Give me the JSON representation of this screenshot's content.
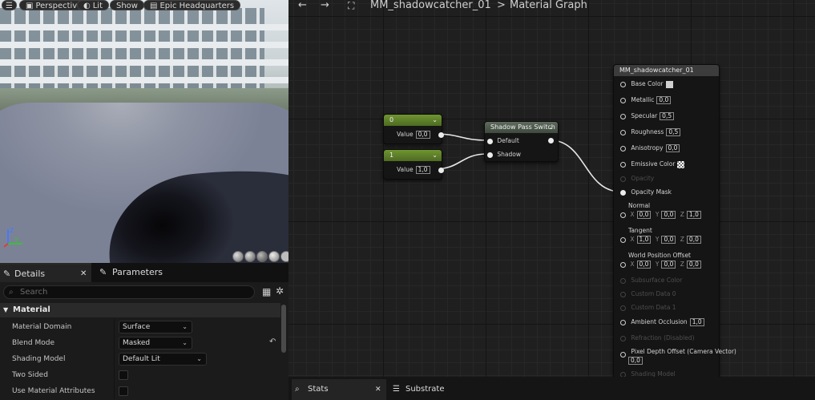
{
  "viewport": {
    "toolbar": {
      "perspective": "Perspective",
      "lit": "Lit",
      "show": "Show",
      "hdri": "Epic Headquarters"
    }
  },
  "details": {
    "tab_details": "Details",
    "tab_parameters": "Parameters",
    "search_placeholder": "Search",
    "category": "Material",
    "props": [
      {
        "name": "Material Domain",
        "value": "Surface"
      },
      {
        "name": "Blend Mode",
        "value": "Masked"
      },
      {
        "name": "Shading Model",
        "value": "Default Lit"
      },
      {
        "name": "Two Sided",
        "checked": false
      },
      {
        "name": "Use Material Attributes",
        "checked": false
      }
    ]
  },
  "graph": {
    "breadcrumb_asset": "MM_shadowcatcher_01",
    "breadcrumb_sep": ">",
    "breadcrumb_view": "Material Graph",
    "const0": {
      "title": "0",
      "label": "Value",
      "value": "0,0"
    },
    "const1": {
      "title": "1",
      "label": "Value",
      "value": "1,0"
    },
    "switch": {
      "title": "Shadow Pass Switch",
      "in_default": "Default",
      "in_shadow": "Shadow"
    },
    "result": {
      "title": "MM_shadowcatcher_01",
      "base_color": "Base Color",
      "metallic": "Metallic",
      "metallic_val": "0,0",
      "specular": "Specular",
      "specular_val": "0,5",
      "roughness": "Roughness",
      "roughness_val": "0,5",
      "anisotropy": "Anisotropy",
      "anisotropy_val": "0,0",
      "emissive": "Emissive Color",
      "opacity": "Opacity",
      "opacity_mask": "Opacity Mask",
      "normal": "Normal",
      "normal_x": "0,0",
      "normal_y": "0,0",
      "normal_z": "1,0",
      "tangent": "Tangent",
      "tangent_x": "1,0",
      "tangent_y": "0,0",
      "tangent_z": "0,0",
      "wpo": "World Position Offset",
      "wpo_x": "0,0",
      "wpo_y": "0,0",
      "wpo_z": "0,0",
      "x": "X",
      "y": "Y",
      "z": "Z",
      "subsurface": "Subsurface Color",
      "custom0": "Custom Data 0",
      "custom1": "Custom Data 1",
      "ao": "Ambient Occlusion",
      "ao_val": "1,0",
      "refraction": "Refraction (Disabled)",
      "pdo": "Pixel Depth Offset (Camera Vector)",
      "pdo_val": "0,0",
      "shading_model": "Shading Model"
    }
  },
  "bottom": {
    "stats": "Stats",
    "substrate": "Substrate"
  },
  "colors": {
    "const_header": "#5b7a2b",
    "switch_header": "#4d5a4b",
    "result_header": "#3a3a3a",
    "accent": "#f0f0f0"
  }
}
